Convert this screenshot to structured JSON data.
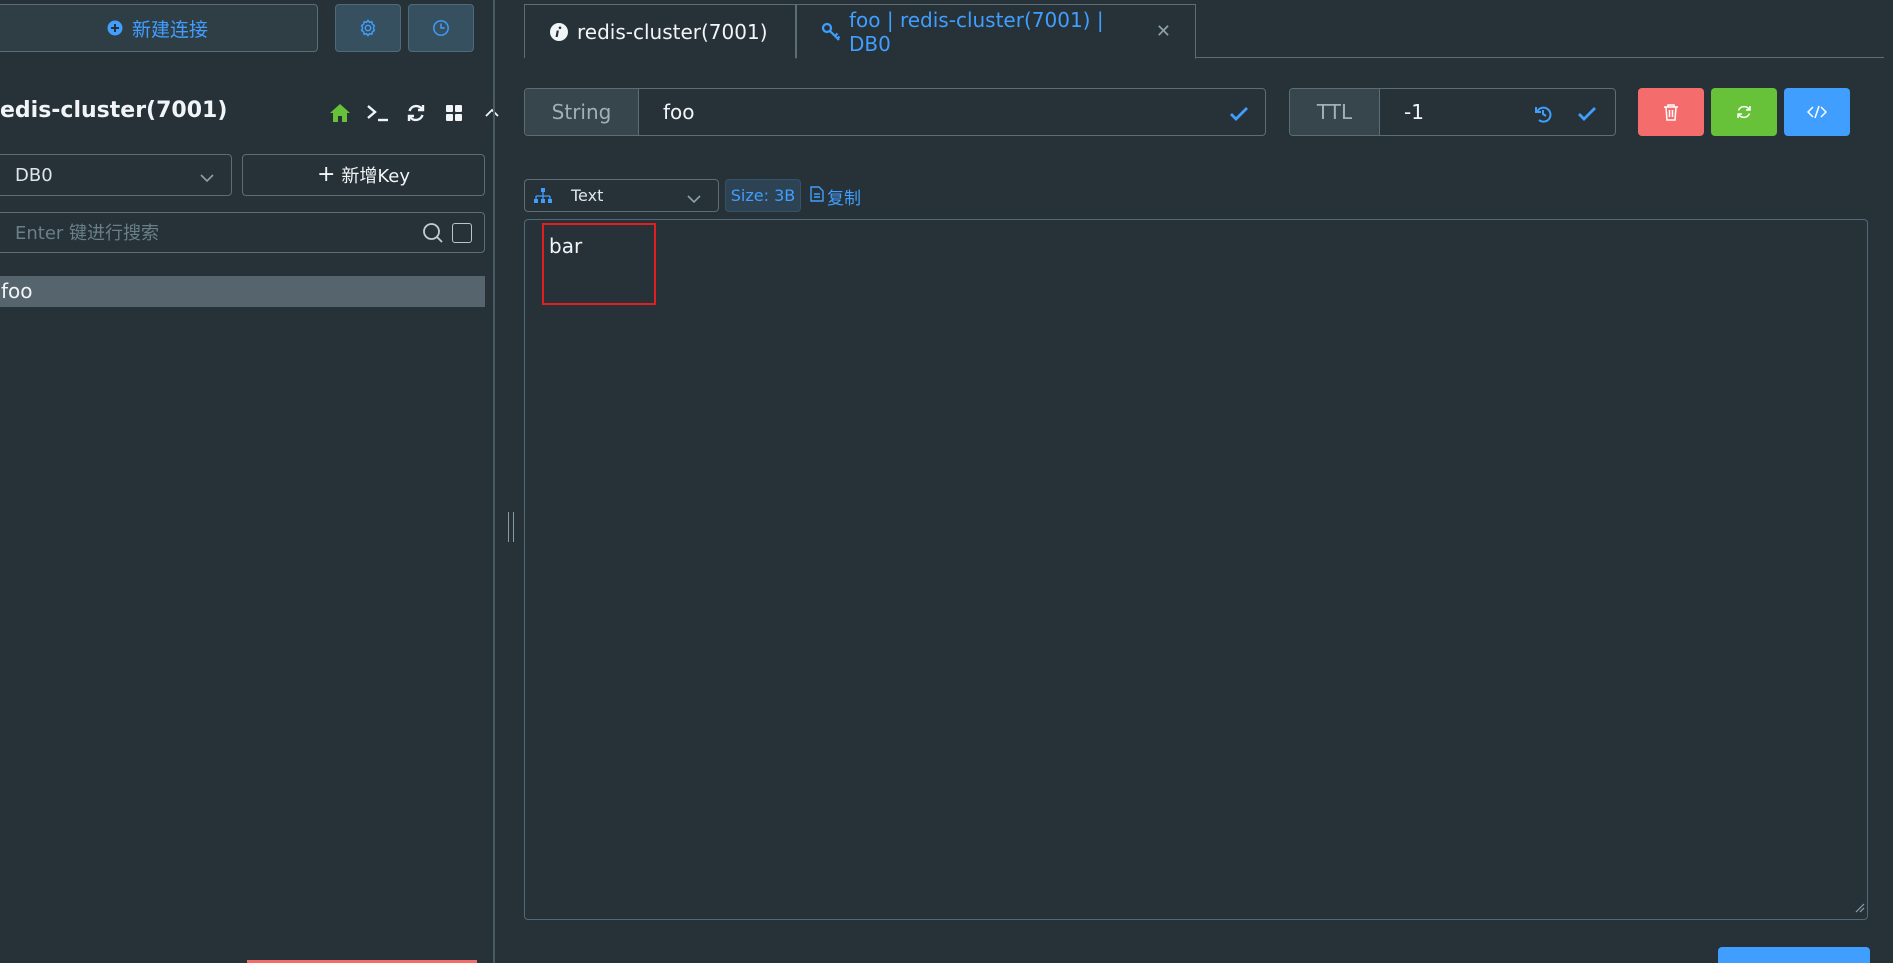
{
  "sidebar": {
    "new_connection_label": "新建连接",
    "connection_name": "edis-cluster(7001)",
    "db_selected": "DB0",
    "new_key_label": "新增Key",
    "search_placeholder": "Enter 键进行搜索",
    "keys": [
      "foo"
    ]
  },
  "tabs": [
    {
      "label": "redis-cluster(7001)",
      "icon": "info-icon"
    },
    {
      "label": "foo | redis-cluster(7001) | DB0",
      "icon": "key-icon"
    }
  ],
  "key_detail": {
    "type_label": "String",
    "key_name": "foo",
    "ttl_label": "TTL",
    "ttl_value": "-1",
    "format_label": "Text",
    "size_badge": "Size: 3B",
    "copy_label": "复制",
    "value": "bar"
  },
  "colors": {
    "background": "#263238",
    "accent": "#409eff",
    "danger": "#f56c6c",
    "success": "#67c23a",
    "highlight": "#e02020"
  }
}
